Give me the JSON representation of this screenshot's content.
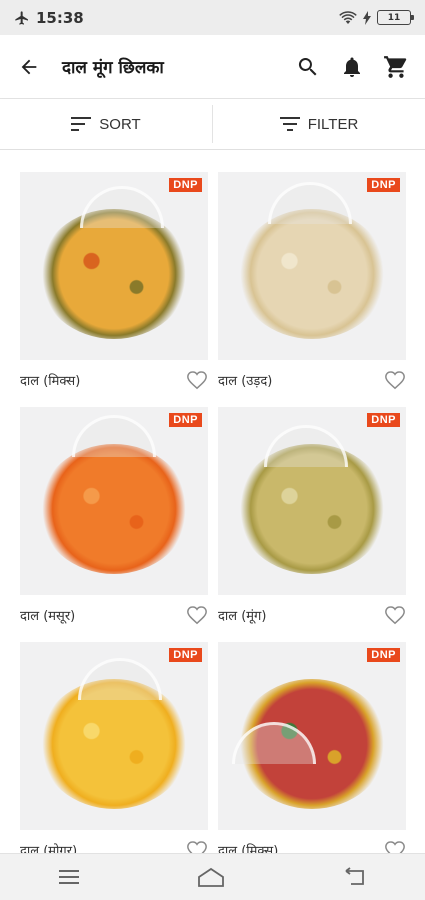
{
  "status": {
    "time": "15:38",
    "battery": "11"
  },
  "header": {
    "title": "दाल मूंग छिलका"
  },
  "toolbar": {
    "sort_label": "SORT",
    "filter_label": "FILTER"
  },
  "products": [
    {
      "name": "दाल (मिक्स)",
      "badge": "DNP",
      "colors": [
        "#e8a93a",
        "#8a7a2a",
        "#d9641f"
      ]
    },
    {
      "name": "दाल (उड़द)",
      "badge": "DNP",
      "colors": [
        "#e6d6b3",
        "#d8c393",
        "#f0e6cc"
      ]
    },
    {
      "name": "दाल (मसूर)",
      "badge": "DNP",
      "colors": [
        "#f07b2a",
        "#e8631a",
        "#f59a4a"
      ]
    },
    {
      "name": "दाल (मूंग)",
      "badge": "DNP",
      "colors": [
        "#c9b86a",
        "#a89a45",
        "#ddd39a"
      ]
    },
    {
      "name": "दाल (मोगर)",
      "badge": "DNP",
      "colors": [
        "#f4c23a",
        "#efae1f",
        "#f8d86a"
      ]
    },
    {
      "name": "दाल (मिक्स)",
      "badge": "DNP",
      "colors": [
        "#c2423a",
        "#d9a22a",
        "#3d7a3a"
      ]
    }
  ],
  "colors": {
    "accent": "#e9491c",
    "status_bar": "#ededed",
    "nav_bar": "#f2f2f2"
  }
}
